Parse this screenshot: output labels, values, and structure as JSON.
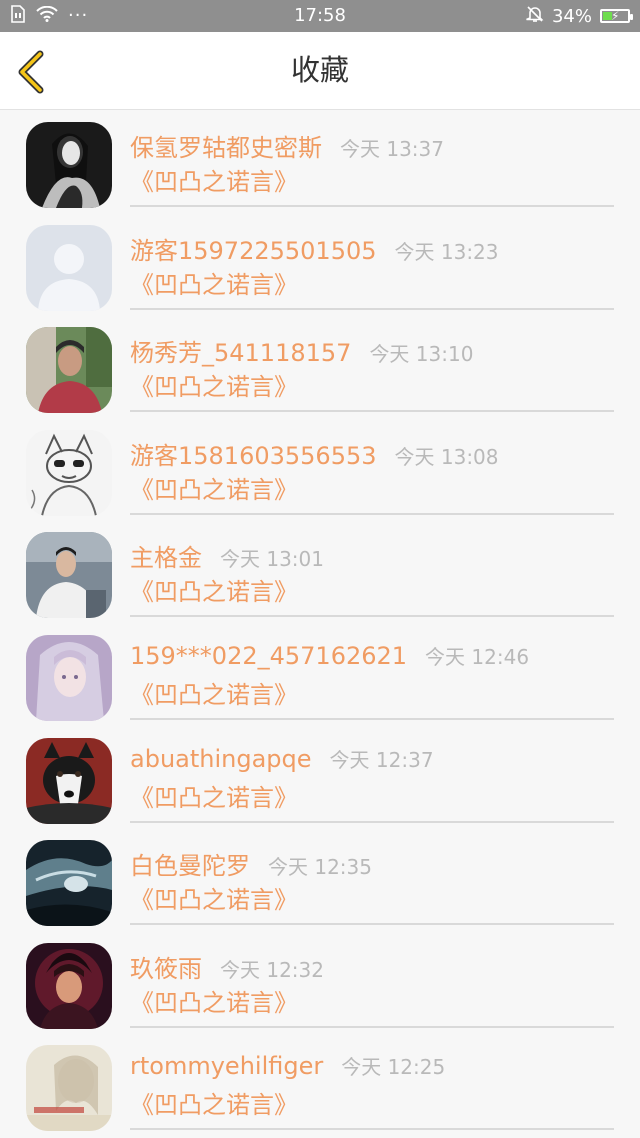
{
  "status_bar": {
    "time": "17:58",
    "battery_percent": "34%",
    "battery_level": 0.34,
    "icons": [
      "sim-icon",
      "wifi-icon",
      "more-dots-icon",
      "mute-bell-icon",
      "battery-charging-icon"
    ],
    "more_dots": "···"
  },
  "header": {
    "title": "收藏",
    "back_icon": "chevron-left-icon",
    "accent": "#f5c518"
  },
  "colors": {
    "name": "#f09c63",
    "time": "#b9b9b9",
    "title": "#333333"
  },
  "favorites": [
    {
      "name": "保氢罗轱都史密斯",
      "time": "今天 13:37",
      "book": "《凹凸之诺言》"
    },
    {
      "name": "游客1597225501505",
      "time": "今天 13:23",
      "book": "《凹凸之诺言》"
    },
    {
      "name": "杨秀芳_541118157",
      "time": "今天 13:10",
      "book": "《凹凸之诺言》"
    },
    {
      "name": "游客1581603556553",
      "time": "今天 13:08",
      "book": "《凹凸之诺言》"
    },
    {
      "name": "主格金",
      "time": "今天 13:01",
      "book": "《凹凸之诺言》"
    },
    {
      "name": "159***022_457162621",
      "time": "今天 12:46",
      "book": "《凹凸之诺言》"
    },
    {
      "name": "abuathingapqe",
      "time": "今天 12:37",
      "book": "《凹凸之诺言》"
    },
    {
      "name": "白色曼陀罗",
      "time": "今天 12:35",
      "book": "《凹凸之诺言》"
    },
    {
      "name": "玖筱雨",
      "time": "今天 12:32",
      "book": "《凹凸之诺言》"
    },
    {
      "name": "rtommyehilfiger",
      "time": "今天 12:25",
      "book": "《凹凸之诺言》"
    }
  ]
}
